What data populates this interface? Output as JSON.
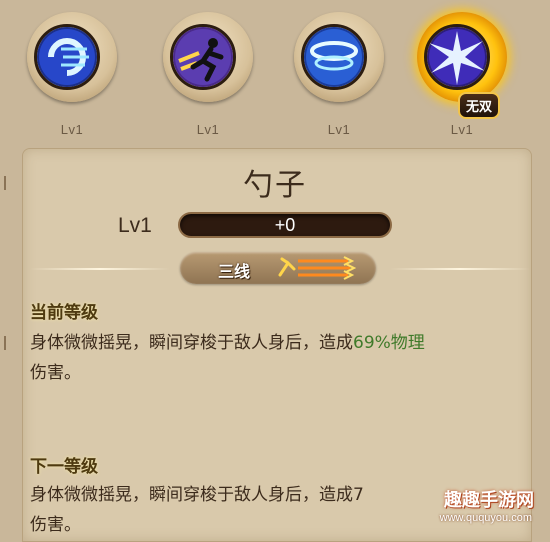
{
  "skills": [
    {
      "level": "Lv1",
      "icon": "swirl-slash-icon",
      "selected": false
    },
    {
      "level": "Lv1",
      "icon": "dash-runner-icon",
      "selected": false
    },
    {
      "level": "Lv1",
      "icon": "whirlwind-icon",
      "selected": false
    },
    {
      "level": "Lv1",
      "icon": "lightning-burst-icon",
      "selected": true,
      "badge": "无双"
    }
  ],
  "detail": {
    "name": "勺子",
    "level_label": "Lv1",
    "bar_text": "+0",
    "bar_progress": 0,
    "tag_text": "三线"
  },
  "current": {
    "title": "当前等级",
    "text_before": "身体微微摇晃，瞬间穿梭于敌人身后，造成",
    "highlight": "69%物理",
    "text_after": "伤害。"
  },
  "next": {
    "title": "下一等级",
    "text_line1": "身体微微摇晃，瞬间穿梭于敌人身后，造成7",
    "text_line2": "伤害。"
  },
  "watermark": {
    "title": "趣趣手游网",
    "url": "www.ququyou.com"
  },
  "colors": {
    "accent_gold": "#ffc20e",
    "highlight_green": "#3f7a2a",
    "parchment": "#d9c9ab"
  }
}
